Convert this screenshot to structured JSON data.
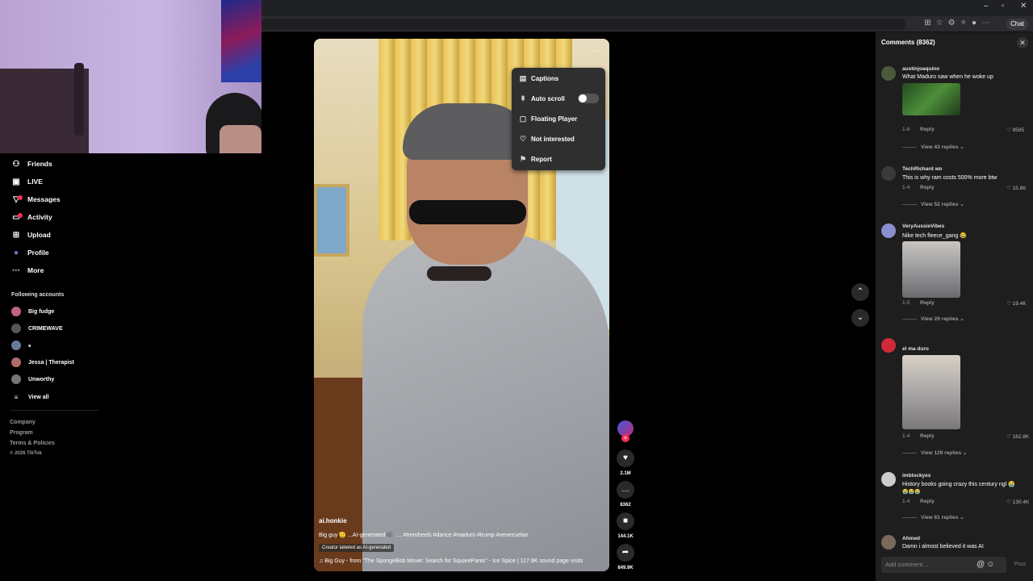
{
  "browser": {
    "window_controls": [
      "–",
      "▫",
      "✕"
    ],
    "chat_button": "Chat"
  },
  "sidebar": {
    "nav": [
      {
        "label": "Friends",
        "icon": "friends-icon"
      },
      {
        "label": "LIVE",
        "icon": "live-icon"
      },
      {
        "label": "Messages",
        "icon": "messages-icon",
        "badge": true
      },
      {
        "label": "Activity",
        "icon": "activity-icon",
        "badge": true
      },
      {
        "label": "Upload",
        "icon": "upload-icon"
      },
      {
        "label": "Profile",
        "icon": "profile-icon"
      },
      {
        "label": "More",
        "icon": "more-icon"
      }
    ],
    "following_title": "Following accounts",
    "accounts": [
      {
        "name": "Big fudge",
        "color": "#c0647a"
      },
      {
        "name": "CRIMEWAVE",
        "color": "#555555"
      },
      {
        "name": "⁎",
        "color": "#6b7a9a"
      },
      {
        "name": "Jessa | Therapist",
        "color": "#b56a6a"
      },
      {
        "name": "Unworthy",
        "color": "#777777"
      }
    ],
    "view_all": "View all",
    "footer": [
      "Company",
      "Program",
      "Terms & Policies",
      "© 2026 TikTok"
    ]
  },
  "video": {
    "menu": {
      "captions": "Captions",
      "auto_scroll": "Auto scroll",
      "auto_scroll_on": false,
      "floating_player": "Floating Player",
      "not_interested": "Not interested",
      "report": "Report"
    },
    "username": "ai.honkie",
    "caption": "Big guy 🫡 ...AI-generated 🎼 .... #trendreels #dance #maduro #trump #venezuelan",
    "ai_label": "Creator labeled as AI-generated",
    "sound": "♫  Big Guy - from \"The SpongeBob Movie: Search for SquarePants\" - Ice Spice | 117.8K sound page visits",
    "likes": "2.1M",
    "comments": "8362",
    "saves": "144.1K",
    "shares": "849.9K"
  },
  "comments_panel": {
    "title": "Comments (8362)",
    "input_placeholder": "Add comment...",
    "post": "Post",
    "comments": [
      {
        "user": "austinjoaquino",
        "text": "What Maduro saw when he woke up",
        "date": "1-6",
        "reply": "Reply",
        "likes": "9595",
        "view": "View 43 replies",
        "avatar": "#4a5a3a"
      },
      {
        "user": "TechRichard ᴍᴅ",
        "text": "This is why ram costs 500% more btw",
        "date": "1-4",
        "reply": "Reply",
        "likes": "15.8K",
        "view": "View 52 replies",
        "avatar": "#3a3a3a"
      },
      {
        "user": "VeryAussieVibes",
        "text": "Nike tech fleece_gang 😂",
        "date": "1-5",
        "reply": "Reply",
        "likes": "19.4K",
        "view": "View 29 replies",
        "avatar": "#8a8fd0"
      },
      {
        "user": "el ma duro",
        "text": "",
        "date": "1-4",
        "reply": "Reply",
        "likes": "162.8K",
        "view": "View 129 replies",
        "avatar": "#d02a3a"
      },
      {
        "user": "imblockyes",
        "text": "History books going crazy this century ngl 😭",
        "text2": "😭😭😭",
        "date": "1-4",
        "reply": "Reply",
        "likes": "130.4K",
        "view": "View 61 replies",
        "avatar": "#cccccc"
      },
      {
        "user": "Ahmed",
        "text": "Damn i almost believed it was AI",
        "avatar": "#7a6a5a"
      }
    ]
  }
}
